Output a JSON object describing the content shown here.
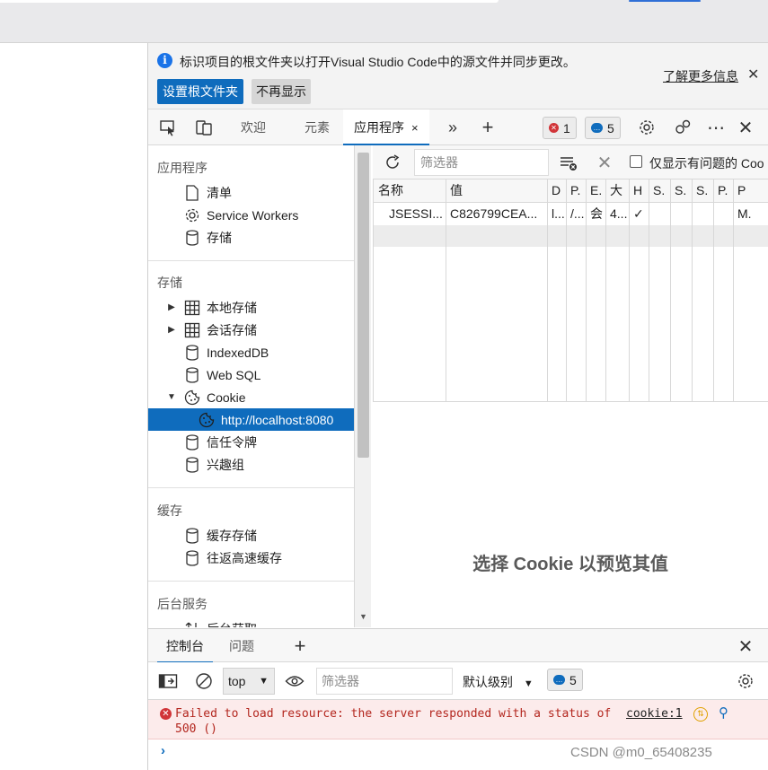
{
  "infobar": {
    "message": "标识项目的根文件夹以打开Visual Studio Code中的源文件并同步更改。",
    "learn_more": "了解更多信息",
    "primary_button": "设置根文件夹",
    "secondary_button": "不再显示"
  },
  "tabs": {
    "welcome": "欢迎",
    "elements": "元素",
    "application": "应用程序",
    "close_glyph": "×",
    "more": "»",
    "add": "+",
    "errors_count": "1",
    "messages_count": "5"
  },
  "sidebar": {
    "app_section": "应用程序",
    "app_items": [
      "清单",
      "Service Workers",
      "存储"
    ],
    "storage_section": "存储",
    "storage_items": [
      "本地存储",
      "会话存储",
      "IndexedDB",
      "Web SQL",
      "Cookie",
      "http://localhost:8080",
      "信任令牌",
      "兴趣组"
    ],
    "cache_section": "缓存",
    "cache_items": [
      "缓存存储",
      "往返高速缓存"
    ],
    "bg_section": "后台服务",
    "bg_items": [
      "后台获取"
    ]
  },
  "cookies": {
    "filter_placeholder": "筛选器",
    "only_issues": "仅显示有问题的 Coo",
    "columns": [
      "名称",
      "值",
      "D",
      "P.",
      "E.",
      "大",
      "H",
      "S.",
      "S.",
      "S.",
      "P.",
      "P"
    ],
    "row": [
      "JSESSI...",
      "C826799CEA...",
      "l...",
      "/...",
      "会",
      "4...",
      "✓",
      "",
      "",
      "",
      "",
      "M."
    ],
    "preview_empty": "选择 Cookie 以预览其值"
  },
  "drawer": {
    "console_tab": "控制台",
    "issues_tab": "问题",
    "add": "+",
    "context": "top",
    "filter_placeholder": "筛选器",
    "level": "默认级别",
    "messages_count": "5"
  },
  "console": {
    "error_message": "Failed to load resource: the server responded with a status of 500 ()",
    "source_link": "cookie:1",
    "prompt": "›"
  },
  "watermark": "CSDN @m0_65408235"
}
